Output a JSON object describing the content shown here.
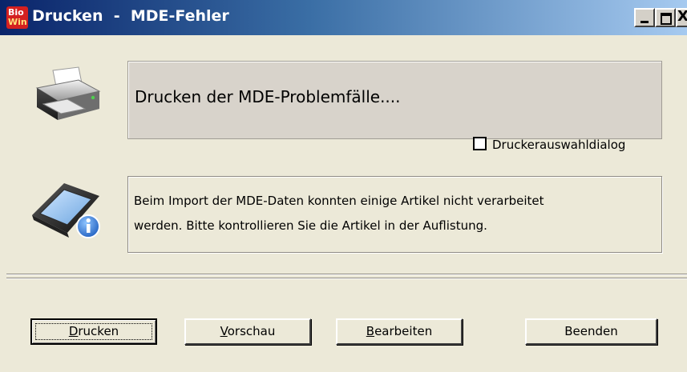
{
  "window": {
    "title": "Drucken  -  MDE-Fehler",
    "app_icon_text": [
      "Bio",
      "Win"
    ]
  },
  "title_buttons": {
    "minimize": "_",
    "maximize": "□",
    "close": "X"
  },
  "print_panel": {
    "text": "Drucken der MDE-Problemfälle....",
    "icon": "printer-icon"
  },
  "printer_dialog_checkbox": {
    "label": "Druckerauswahldialog",
    "checked": false
  },
  "info_panel": {
    "icon": "pda-info-icon",
    "lines": [
      "Beim Import der MDE-Daten konnten einige Artikel nicht verarbeitet",
      "werden. Bitte kontrollieren Sie die Artikel in der Auflistung."
    ]
  },
  "buttons": [
    {
      "mnemonic": "D",
      "rest": "rucken"
    },
    {
      "mnemonic": "V",
      "rest": "orschau"
    },
    {
      "mnemonic": "B",
      "rest": "earbeiten"
    },
    {
      "mnemonic": "",
      "rest": "Beenden"
    }
  ],
  "colors": {
    "dialog_bg": "#ece9d8",
    "titlebar_start": "#0a246a",
    "titlebar_end": "#a6caf0",
    "app_icon": "#d42020"
  }
}
